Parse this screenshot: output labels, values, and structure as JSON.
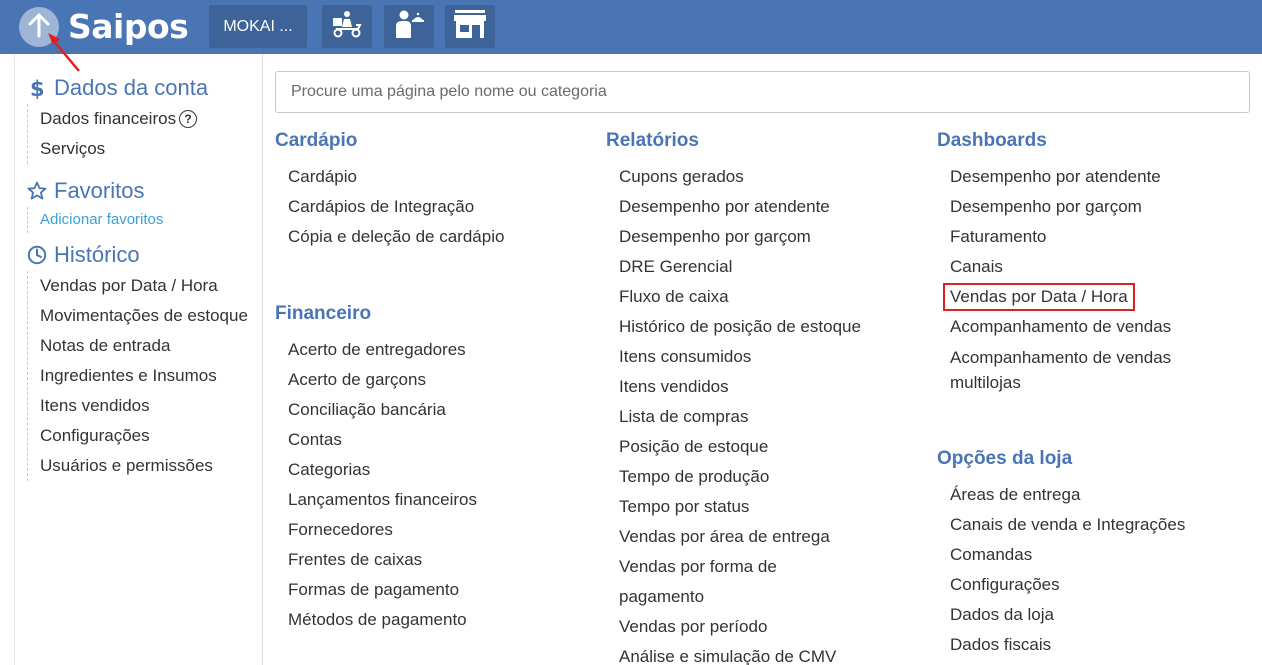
{
  "header": {
    "logo_text": "Saipos",
    "store_label": "MOKAI ...",
    "icons": [
      "delivery-scooter-icon",
      "waiter-icon",
      "storefront-icon"
    ]
  },
  "sidebar": {
    "account": {
      "title": "Dados da conta",
      "icon": "dollar-icon",
      "items": [
        "Dados financeiros",
        "Serviços"
      ],
      "help_glyph": "?"
    },
    "favorites": {
      "title": "Favoritos",
      "icon": "star-icon",
      "link": "Adicionar favoritos"
    },
    "history": {
      "title": "Histórico",
      "icon": "clock-icon",
      "items": [
        "Vendas por Data / Hora",
        "Movimentações de estoque",
        "Notas de entrada",
        "Ingredientes e Insumos",
        "Itens vendidos",
        "Configurações",
        "Usuários e permissões"
      ]
    }
  },
  "search": {
    "placeholder": "Procure uma página pelo nome ou categoria"
  },
  "categories": {
    "cardapio": {
      "title": "Cardápio",
      "items": [
        "Cardápio",
        "Cardápios de Integração",
        "Cópia e deleção de cardápio"
      ]
    },
    "financeiro": {
      "title": "Financeiro",
      "items": [
        "Acerto de entregadores",
        "Acerto de garçons",
        "Conciliação bancária",
        "Contas",
        "Categorias",
        "Lançamentos financeiros",
        "Fornecedores",
        "Frentes de caixas",
        "Formas de pagamento",
        "Métodos de pagamento"
      ]
    },
    "relatorios": {
      "title": "Relatórios",
      "items": [
        "Cupons gerados",
        "Desempenho por atendente",
        "Desempenho por garçom",
        "DRE Gerencial",
        "Fluxo de caixa",
        "Histórico de posição de estoque",
        "Itens consumidos",
        "Itens vendidos",
        "Lista de compras",
        "Posição de estoque",
        "Tempo de produção",
        "Tempo por status",
        "Vendas por área de entrega",
        "Vendas por forma de pagamento",
        "Vendas por período",
        "Análise e simulação de CMV"
      ]
    },
    "dashboards": {
      "title": "Dashboards",
      "items": [
        "Desempenho por atendente",
        "Desempenho por garçom",
        "Faturamento",
        "Canais",
        "Vendas por Data / Hora",
        "Acompanhamento de vendas",
        "Acompanhamento de vendas multilojas"
      ]
    },
    "opcoes": {
      "title": "Opções da loja",
      "items": [
        "Áreas de entrega",
        "Canais de venda e Integrações",
        "Comandas",
        "Configurações",
        "Dados da loja",
        "Dados fiscais"
      ]
    }
  },
  "colors": {
    "brand": "#4a75b4",
    "header_button": "#3d6398",
    "link": "#3aa0d8",
    "highlight": "#e02020"
  }
}
